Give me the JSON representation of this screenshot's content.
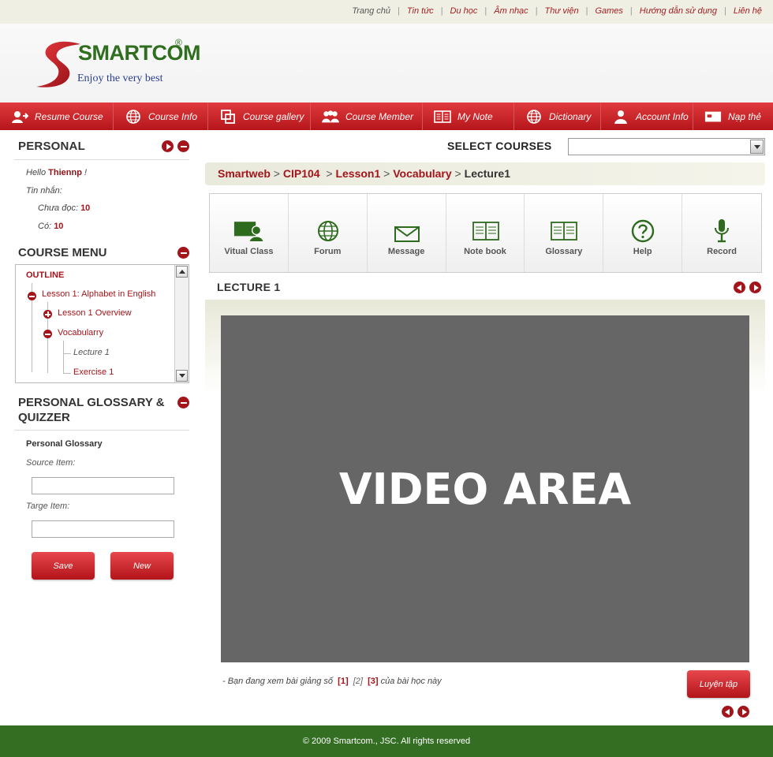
{
  "top_links": [
    "Trang chủ",
    "Tin tức",
    "Du học",
    "Âm nhạc",
    "Thư viện",
    "Games",
    "Hướng dẫn sử dụng",
    "Liên hệ"
  ],
  "brand": {
    "name": "SMARTCOM",
    "reg": "®",
    "tagline": "Enjoy the very best"
  },
  "nav": [
    "Resume Course",
    "Course Info",
    "Course gallery",
    "Course Member",
    "My Note",
    "Dictionary",
    "Account Info",
    "Nạp thẻ"
  ],
  "personal": {
    "title": "PERSONAL",
    "hello_prefix": "Hello",
    "username": "Thiennp",
    "hello_suffix": "!",
    "messages_label": "Tin nhắn:",
    "unread_label": "Chưa đọc:",
    "unread_count": "10",
    "total_label": "Có:",
    "total_count": "10"
  },
  "course_menu": {
    "title": "COURSE MENU",
    "outline": "OUTLINE",
    "items": [
      "Lesson 1: Alphabet in English",
      "Lesson 1 Overview",
      "Vocabularry",
      "Lecture 1",
      "Exercise 1"
    ]
  },
  "glossary": {
    "title_line1": "PERSONAL GLOSSARY &",
    "title_line2": "QUIZZER",
    "subtitle": "Personal Glossary",
    "source_label": "Source Item:",
    "target_label": "Targe Item:",
    "save": "Save",
    "new": "New"
  },
  "select_courses": {
    "label": "SELECT COURSES",
    "value": ""
  },
  "breadcrumb": {
    "items": [
      "Smartweb",
      "CIP104",
      "Lesson1",
      "Vocabulary"
    ],
    "current": "Lecture1"
  },
  "tools": [
    "Vitual Class",
    "Forum",
    "Message",
    "Note book",
    "Glossary",
    "Help",
    "Record"
  ],
  "lecture": {
    "title": "LECTURE 1",
    "video_text": "VIDEO AREA"
  },
  "pagination": {
    "prefix": "- Bạn đang xem bài giảng số",
    "pages": [
      "[1]",
      "[2]",
      "[3]"
    ],
    "suffix": "của bài học này",
    "practice": "Luyện tập"
  },
  "footer": "© 2009 Smartcom., JSC. All rights reserved",
  "colors": {
    "brand_red": "#a3151b",
    "brand_green": "#336e23",
    "video_gray": "#666666"
  }
}
